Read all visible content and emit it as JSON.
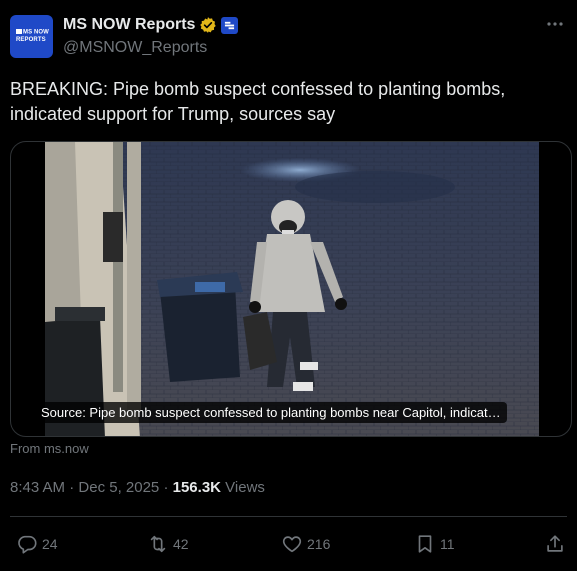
{
  "account": {
    "display_name": "MS NOW Reports",
    "handle": "@MSNOW_Reports",
    "avatar_line1": "MS NOW",
    "avatar_line2": "REPORTS",
    "verified_badge_color": "#e2b719",
    "org_badge_color": "#1f49c7"
  },
  "post": {
    "text": "BREAKING: Pipe bomb suspect confessed to planting bombs, indicated support for Trump, sources say",
    "media_caption": "Source: Pipe bomb suspect confessed to planting bombs near Capitol, indicat…",
    "link_source": "From ms.now",
    "time": "8:43 AM",
    "separator": "·",
    "date": "Dec 5, 2025",
    "views_count": "156.3K",
    "views_label": "Views"
  },
  "actions": {
    "replies": "24",
    "reposts": "42",
    "likes": "216",
    "bookmarks": "11"
  },
  "icons": {
    "more": "more-horizontal-icon",
    "reply": "speech-bubble-icon",
    "repost": "repost-arrows-icon",
    "like": "heart-icon",
    "bookmark": "bookmark-icon",
    "share": "share-upload-icon"
  },
  "colors": {
    "background": "#000000",
    "text_primary": "#e7e9ea",
    "text_secondary": "#71767b",
    "border": "#2f3336"
  }
}
